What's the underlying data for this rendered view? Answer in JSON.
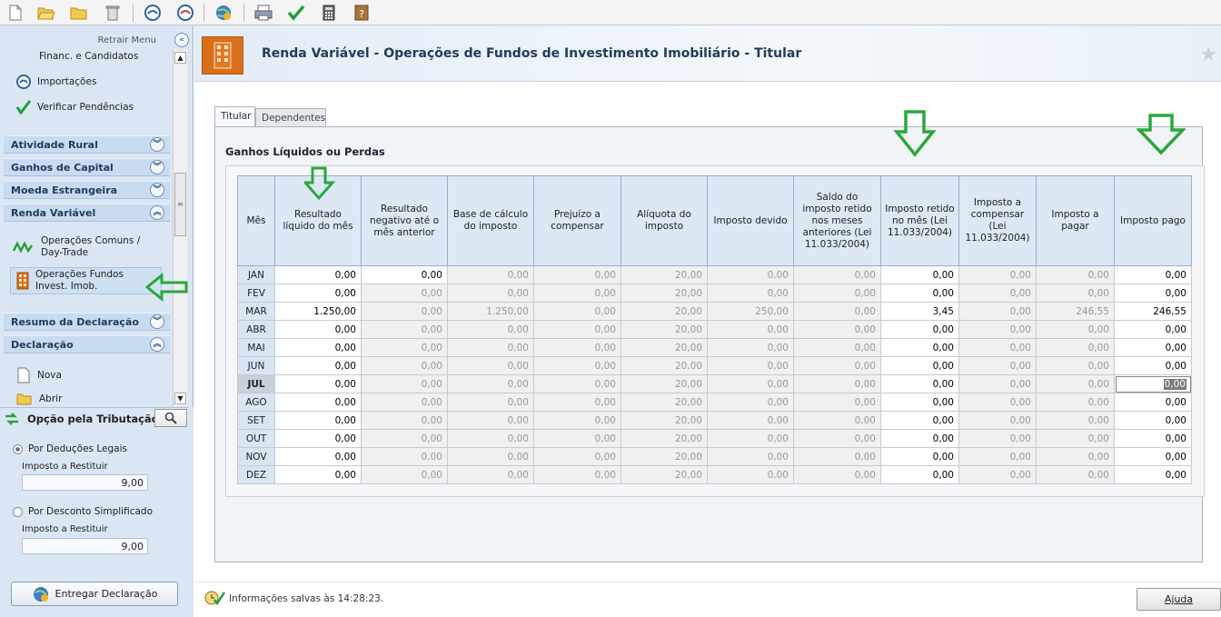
{
  "toolbar": {
    "icons": [
      "new-file-icon",
      "open-folder-icon",
      "folder-icon",
      "trash-icon",
      "receitanet-icon",
      "receitanet-recover-icon",
      "deliver-globe-icon",
      "print-icon",
      "check-icon",
      "calculator-icon",
      "help-book-icon"
    ]
  },
  "sidebar": {
    "retrair_label": "Retrair Menu",
    "items_top": [
      "Financ. e Candidatos",
      "Importações",
      "Verificar Pendências"
    ],
    "sections": {
      "atividade_rural": "Atividade Rural",
      "ganhos_capital": "Ganhos de Capital",
      "moeda_estrangeira": "Moeda Estrangeira",
      "renda_variavel": "Renda Variável",
      "resumo": "Resumo da Declaração",
      "declaracao": "Declaração"
    },
    "rv_items": [
      "Operações Comuns / Day-Trade",
      "Operações Fundos Invest. Imob."
    ],
    "decl_items": [
      "Nova",
      "Abrir"
    ]
  },
  "tributacao": {
    "label": "Opção pela Tributação:",
    "opt1": "Por Deduções Legais",
    "opt1_sub": "Imposto a Restituir",
    "opt1_val": "9,00",
    "opt2": "Por Desconto Simplificado",
    "opt2_sub": "Imposto a Restituir",
    "opt2_val": "9,00",
    "entregar": "Entregar Declaração"
  },
  "header": {
    "title": "Renda Variável - Operações de Fundos de Investimento Imobiliário - Titular"
  },
  "tabs": [
    "Titular",
    "Dependentes"
  ],
  "section_title": "Ganhos Líquidos ou Perdas",
  "table": {
    "headers": [
      "Mês",
      "Resultado líquido do mês",
      "Resultado negativo até o mês anterior",
      "Base de cálculo do imposto",
      "Prejuízo a compensar",
      "Alíquota do imposto",
      "Imposto devido",
      "Saldo do imposto retido nos meses anteriores (Lei 11.033/2004)",
      "Imposto retido no mês (Lei 11.033/2004)",
      "Imposto a compensar (Lei 11.033/2004)",
      "Imposto a pagar",
      "Imposto pago"
    ],
    "rows": [
      [
        "JAN",
        "0,00",
        "0,00",
        "0,00",
        "0,00",
        "20,00",
        "0,00",
        "0,00",
        "0,00",
        "0,00",
        "0,00",
        "0,00"
      ],
      [
        "FEV",
        "0,00",
        "0,00",
        "0,00",
        "0,00",
        "20,00",
        "0,00",
        "0,00",
        "0,00",
        "0,00",
        "0,00",
        "0,00"
      ],
      [
        "MAR",
        "1.250,00",
        "0,00",
        "1.250,00",
        "0,00",
        "20,00",
        "250,00",
        "0,00",
        "3,45",
        "0,00",
        "246,55",
        "246,55"
      ],
      [
        "ABR",
        "0,00",
        "0,00",
        "0,00",
        "0,00",
        "20,00",
        "0,00",
        "0,00",
        "0,00",
        "0,00",
        "0,00",
        "0,00"
      ],
      [
        "MAI",
        "0,00",
        "0,00",
        "0,00",
        "0,00",
        "20,00",
        "0,00",
        "0,00",
        "0,00",
        "0,00",
        "0,00",
        "0,00"
      ],
      [
        "JUN",
        "0,00",
        "0,00",
        "0,00",
        "0,00",
        "20,00",
        "0,00",
        "0,00",
        "0,00",
        "0,00",
        "0,00",
        "0,00"
      ],
      [
        "JUL",
        "0,00",
        "0,00",
        "0,00",
        "0,00",
        "20,00",
        "0,00",
        "0,00",
        "0,00",
        "0,00",
        "0,00",
        "0,00"
      ],
      [
        "AGO",
        "0,00",
        "0,00",
        "0,00",
        "0,00",
        "20,00",
        "0,00",
        "0,00",
        "0,00",
        "0,00",
        "0,00",
        "0,00"
      ],
      [
        "SET",
        "0,00",
        "0,00",
        "0,00",
        "0,00",
        "20,00",
        "0,00",
        "0,00",
        "0,00",
        "0,00",
        "0,00",
        "0,00"
      ],
      [
        "OUT",
        "0,00",
        "0,00",
        "0,00",
        "0,00",
        "20,00",
        "0,00",
        "0,00",
        "0,00",
        "0,00",
        "0,00",
        "0,00"
      ],
      [
        "NOV",
        "0,00",
        "0,00",
        "0,00",
        "0,00",
        "20,00",
        "0,00",
        "0,00",
        "0,00",
        "0,00",
        "0,00",
        "0,00"
      ],
      [
        "DEZ",
        "0,00",
        "0,00",
        "0,00",
        "0,00",
        "20,00",
        "0,00",
        "0,00",
        "0,00",
        "0,00",
        "0,00",
        "0,00"
      ]
    ]
  },
  "status": {
    "text": "Informações salvas às 14:28:23.",
    "ajuda": "Ajuda"
  },
  "colors": {
    "arrow": "#2aa83a",
    "header_bg": "#dde8f5"
  }
}
